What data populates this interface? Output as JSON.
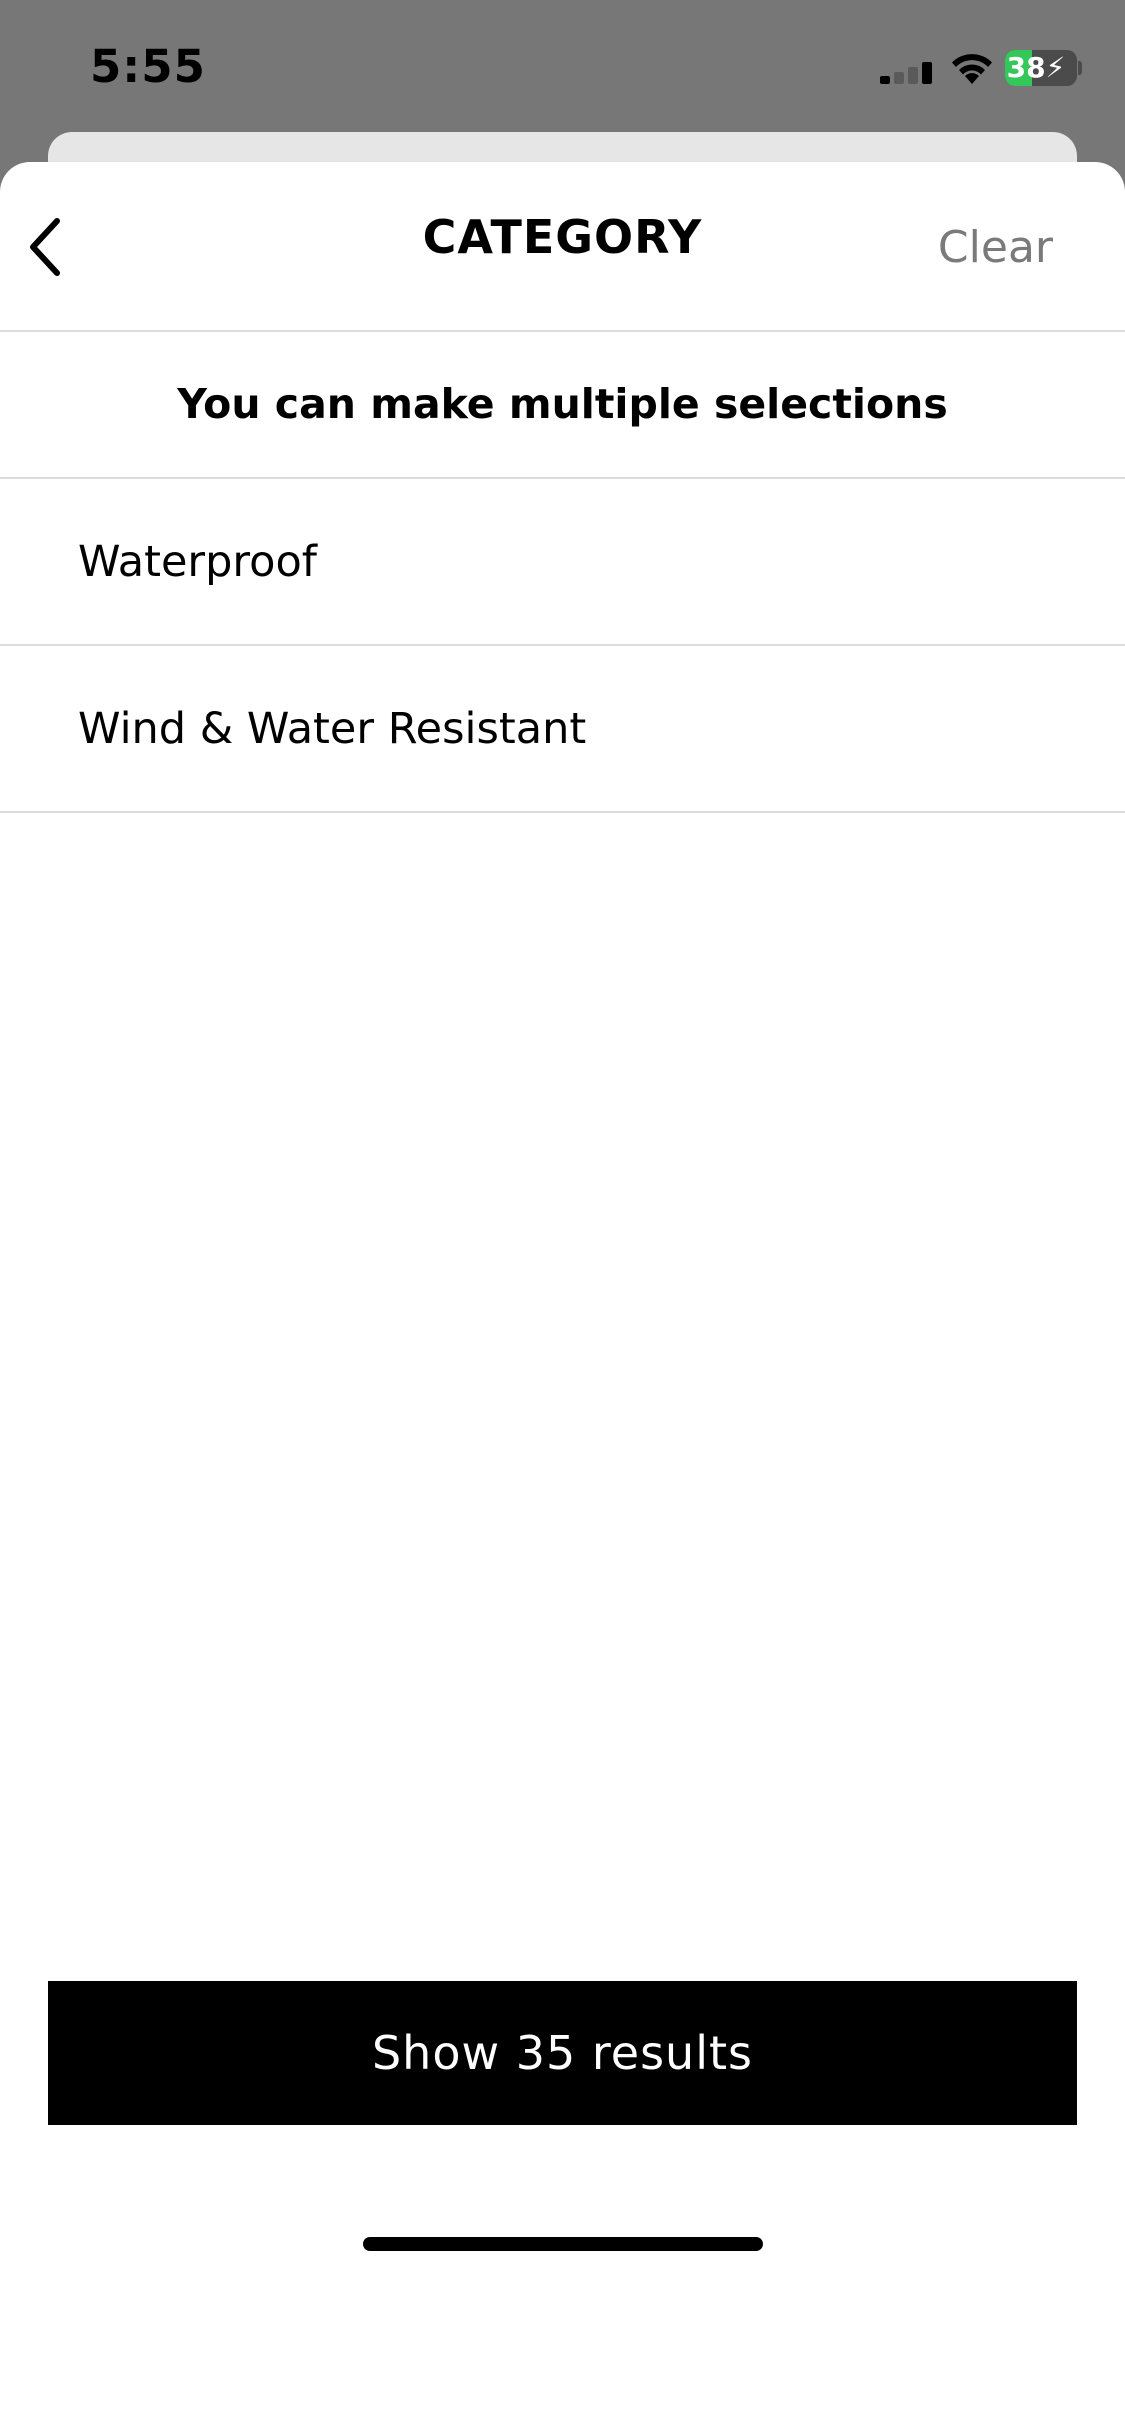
{
  "status_bar": {
    "time": "5:55",
    "battery_level": "38",
    "battery_fraction": 0.38,
    "battery_color": "#34c759",
    "signal_bars_active": 1,
    "signal_bars_total": 4,
    "icons": [
      "cellular-signal-icon",
      "wifi-icon",
      "battery-charging-icon"
    ]
  },
  "header": {
    "title": "CATEGORY",
    "clear_label": "Clear",
    "back_icon": "chevron-left-icon"
  },
  "hint": "You can make multiple selections",
  "options": [
    {
      "label": "Waterproof"
    },
    {
      "label": "Wind & Water Resistant"
    }
  ],
  "cta": {
    "label": "Show 35 results"
  },
  "colors": {
    "backdrop": "#777777",
    "sheet": "#ffffff",
    "cta_background": "#000000",
    "clear_text": "#7a7a7a"
  }
}
